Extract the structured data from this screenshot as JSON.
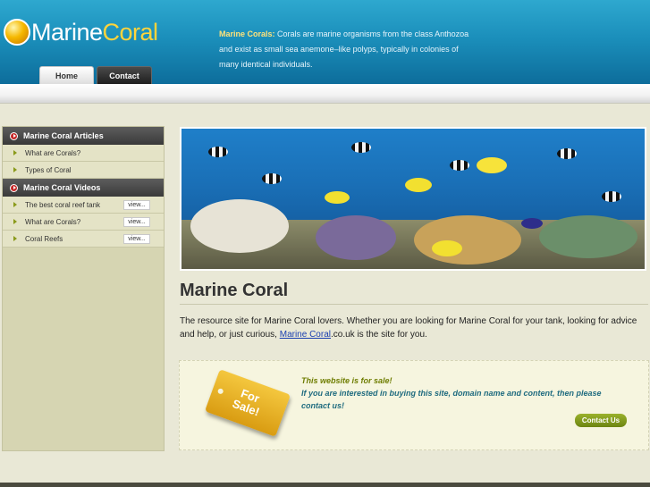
{
  "header": {
    "logo_part1": "Marine",
    "logo_part2": "Coral",
    "intro_strong": "Marine Corals:",
    "intro_rest": " Corals are marine organisms from the class Anthozoa and exist as small sea anemone–like polyps, typically in colonies of many identical individuals."
  },
  "nav": {
    "home": "Home",
    "contact": "Contact Us"
  },
  "sidebar": {
    "articles_heading": "Marine Coral Articles",
    "articles": [
      {
        "label": "What are Corals?"
      },
      {
        "label": "Types of Coral"
      }
    ],
    "videos_heading": "Marine Coral Videos",
    "videos": [
      {
        "label": "The best coral reef tank",
        "view": "view..."
      },
      {
        "label": "What are Corals?",
        "view": "view..."
      },
      {
        "label": "Coral Reefs",
        "view": "view..."
      }
    ]
  },
  "main": {
    "title": "Marine Coral",
    "intro_before_link": "The resource site for Marine Coral lovers.  Whether you are looking for Marine Coral for your tank, looking for advice and help, or just curious, ",
    "intro_link": "Marine Coral",
    "intro_after_link": ".co.uk is the site for you."
  },
  "sale": {
    "tag_line1": "For",
    "tag_line2": "Sale!",
    "line1": "This website is for sale!",
    "line2": "If you are interested in buying this site, domain name and content, then please contact us!",
    "button": "Contact Us"
  },
  "colors": {
    "header_blue": "#1b8fbb",
    "accent_yellow": "#ffd43b",
    "sidebar_bg": "#d6d5b2",
    "contact_button": "#8aa022"
  }
}
